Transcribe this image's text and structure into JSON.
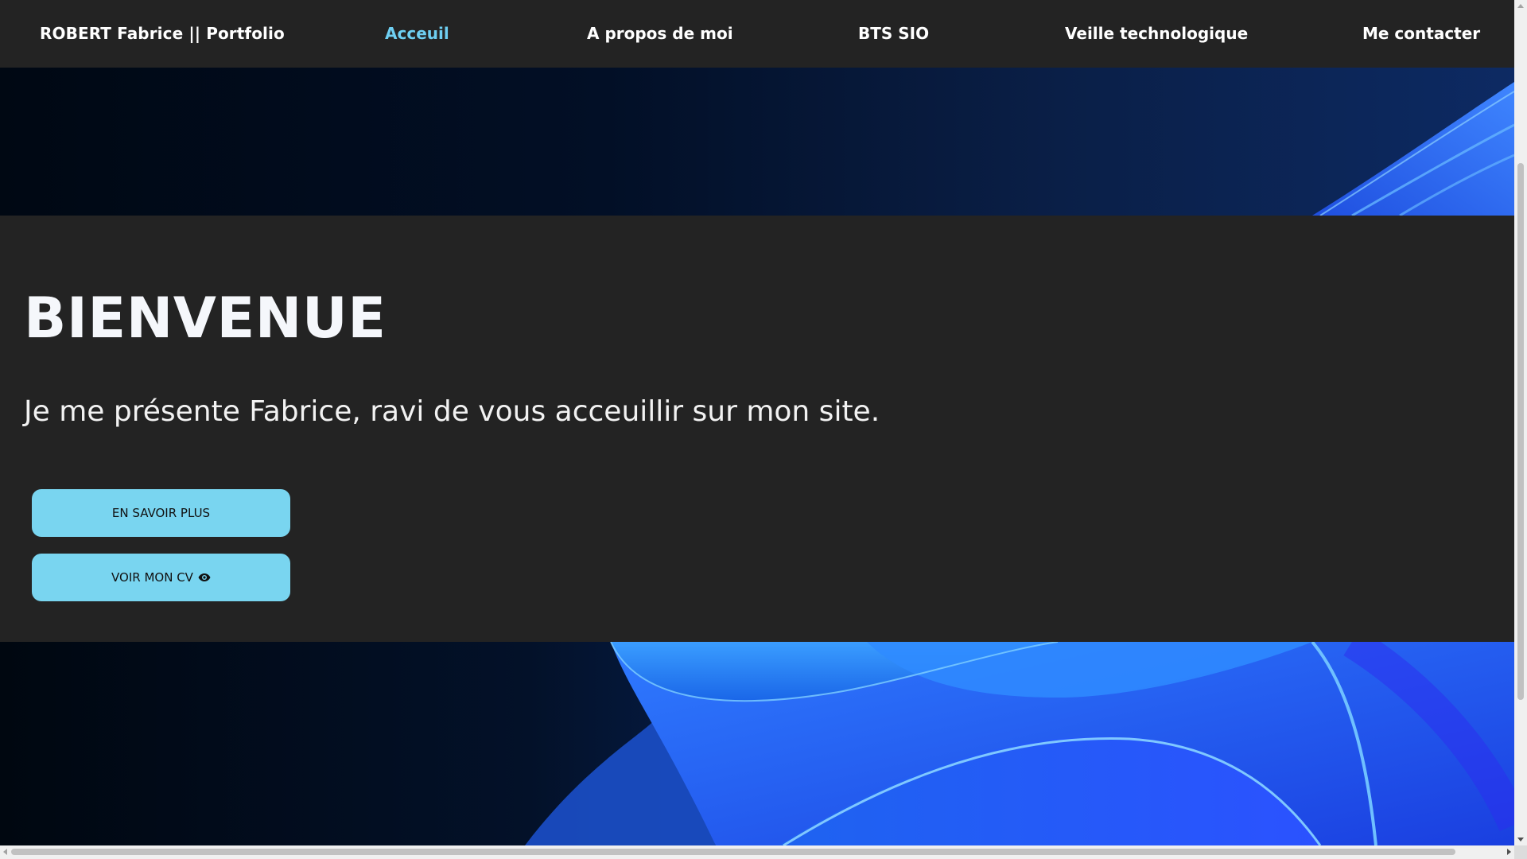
{
  "nav": {
    "brand": "ROBERT Fabrice || Portfolio",
    "links": [
      {
        "label": "Acceuil",
        "active": true
      },
      {
        "label": "A propos de moi",
        "active": false
      },
      {
        "label": "BTS SIO",
        "active": false
      },
      {
        "label": "Veille technologique",
        "active": false
      },
      {
        "label": "Me contacter",
        "active": false
      }
    ]
  },
  "hero": {
    "title": "BIENVENUE",
    "subtitle": "Je me présente Fabrice, ravi de vous acceuillir sur mon site.",
    "buttons": {
      "learn_more": "EN SAVOIR PLUS",
      "view_cv": "VOIR MON CV"
    }
  },
  "icons": {
    "view_cv": "eye-icon"
  },
  "colors": {
    "accent": "#6ecff2",
    "button_bg": "#79d5f0",
    "page_bg": "#232323"
  }
}
